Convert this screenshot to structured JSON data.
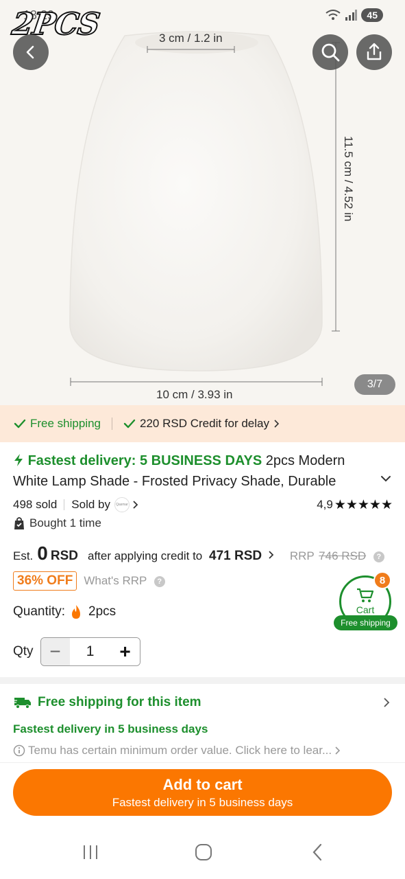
{
  "status_bar": {
    "time": "13:29",
    "battery": "45"
  },
  "watermark": "2PCS",
  "image": {
    "dim_top": "3 cm / 1.2 in",
    "dim_right": "11.5 cm / 4.52 in",
    "dim_bottom": "10 cm / 3.93 in",
    "counter": "3/7"
  },
  "shipping_banner": {
    "free_shipping": "Free shipping",
    "credit": "220 RSD Credit for delay"
  },
  "product": {
    "fastest_delivery": "Fastest delivery: 5 BUSINESS DAYS",
    "title": "2pcs Modern White Lamp Shade - Frosted Privacy Shade, Durable",
    "sold": "498 sold",
    "sold_by": "Sold by",
    "seller_logo_text": "Qasmar",
    "rating": "4,9",
    "stars": "★★★★★",
    "bought": "Bought 1 time"
  },
  "price": {
    "est": "Est.",
    "value": "0",
    "currency": "RSD",
    "after": "after applying credit to",
    "credit_price": "471 RSD",
    "rrp_label": "RRP",
    "rrp_value": "746 RSD",
    "off": "36% OFF",
    "whats_rrp": "What's RRP"
  },
  "quantity": {
    "label": "Quantity:",
    "value": "2pcs",
    "qty_label": "Qty",
    "qty_value": "1",
    "minus": "−",
    "plus": "+"
  },
  "cart": {
    "count": "8",
    "label": "Cart",
    "free_shipping": "Free shipping"
  },
  "free_shipping_section": {
    "title": "Free shipping for this item",
    "fastest": "Fastest delivery in 5 business days",
    "note": "Temu has certain minimum order value. Click here to lear..."
  },
  "add_to_cart": {
    "label": "Add to cart",
    "sub": "Fastest delivery in 5 business days"
  },
  "colors": {
    "accent_orange": "#fb7701",
    "green": "#1d8f2d",
    "banner_bg": "#fde9d9"
  },
  "icons": {
    "back": "chevron-left-icon",
    "search": "search-icon",
    "share": "share-icon",
    "expand": "chevron-down-icon",
    "truck": "truck-icon",
    "bag": "bag-check-icon",
    "info": "info-icon"
  }
}
